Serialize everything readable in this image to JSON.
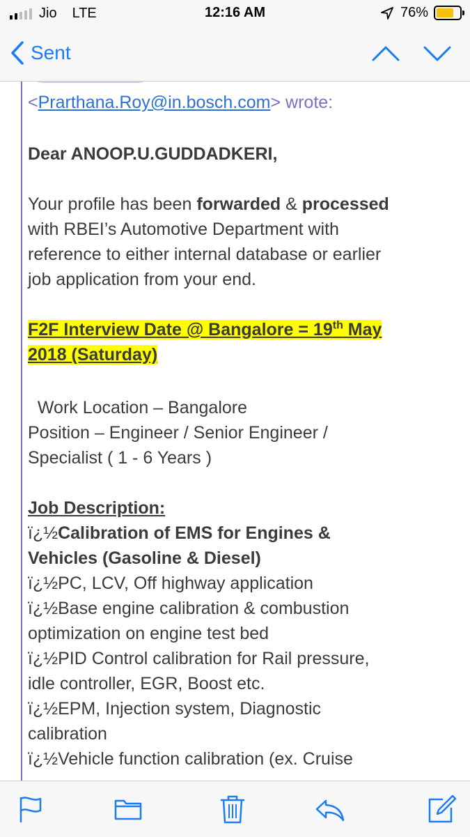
{
  "status_bar": {
    "carrier": "Jio",
    "network": "LTE",
    "time": "12:16 AM",
    "battery_percent": "76%",
    "battery_level": 0.76,
    "battery_color": "#f4c20d",
    "signal_bars": 2,
    "signal_bars_total": 5
  },
  "nav": {
    "back_label": "Sent",
    "accent_color": "#1a7cf5"
  },
  "email": {
    "quote_header": {
      "open_bracket": "<",
      "sender_email": "Prarthana.Roy@in.bosch.com",
      "close": "> wrote:"
    },
    "greeting": "Dear ANOOP.U.GUDDADKERI,",
    "intro": {
      "p1": "Your profile has been ",
      "b1": "forwarded",
      "p2": " & ",
      "b2": "processed",
      "l2": "with RBEI’s Automotive Department with",
      "l3": "reference to either internal database or earlier",
      "l4": "job application from your end."
    },
    "interview": {
      "pre": "F2F Interview Date @ Bangalore = 19",
      "sup": "th",
      "post": " May",
      "line2": "2018 (Saturday)"
    },
    "work_location": "  Work Location – Bangalore",
    "position_l1": "Position – Engineer / Senior Engineer /",
    "position_l2": "Specialist ( 1 - 6 Years )",
    "jd_heading": "Job Description:",
    "bullet_prefix": "ï¿½",
    "bullets": [
      {
        "l1": "Calibration of EMS for Engines &",
        "l2": "Vehicles (Gasoline & Diesel)"
      },
      {
        "l1": "PC, LCV, Off highway application"
      },
      {
        "l1": "Base engine calibration & combustion",
        "l2": "optimization on engine test bed"
      },
      {
        "l1": "PID Control calibration for Rail pressure,",
        "l2": "idle controller, EGR, Boost etc."
      },
      {
        "l1": "EPM, Injection system, Diagnostic",
        "l2": "calibration"
      },
      {
        "l1": "Vehicle function calibration (ex. Cruise"
      }
    ]
  },
  "toolbar": {
    "icons": [
      "flag-icon",
      "folder-icon",
      "trash-icon",
      "reply-icon",
      "compose-icon"
    ]
  }
}
